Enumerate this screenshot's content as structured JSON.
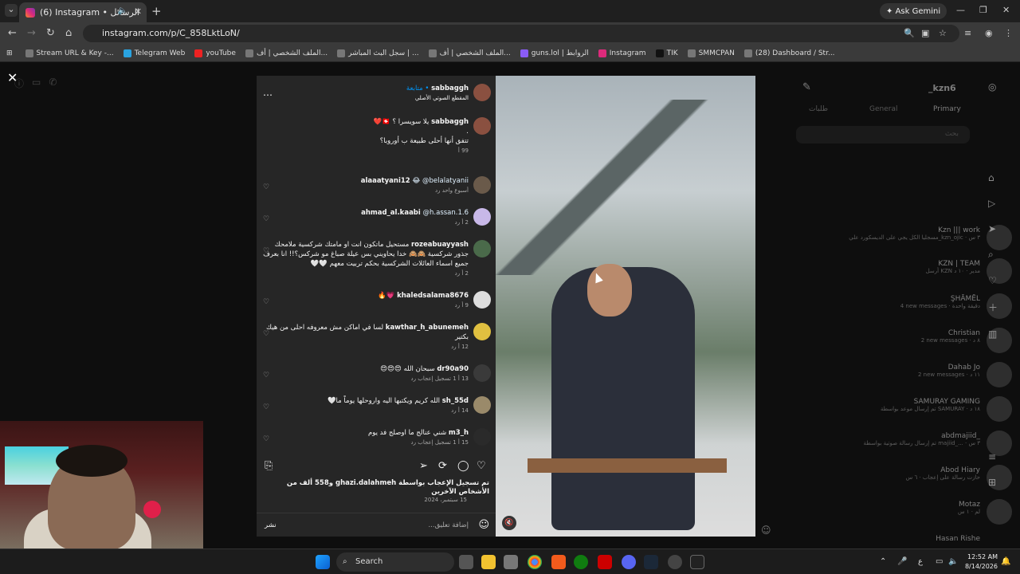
{
  "browser": {
    "tab_title": "(6) Instagram • الرسائل",
    "ask_gemini": "Ask Gemini",
    "url": "instagram.com/p/C_858LktLoN/",
    "bookmarks": [
      "Stream URL & Key -...",
      "Telegram Web",
      "youTube",
      "الملف الشخصي | أف...",
      "سجل البث المباشر | ...",
      "الملف الشخصي | أف...",
      "guns.lol | الروابط",
      "Instagram",
      "TIK",
      "SMMCPAN",
      "(28) Dashboard / Str..."
    ]
  },
  "post": {
    "author": "sabbaggh",
    "follow": "متابعة",
    "audio": "المقطع الصوتي الأصلي",
    "caption_user": "sabbaggh",
    "caption_line1": "يلا سويسرا ؟ 🇨🇭❤️",
    "caption_line2": ".",
    "caption_line3": "تتفق أنها أحلى طبيعة ب أوروبا؟",
    "caption_meta": "99 أ",
    "comments": [
      {
        "user": "alaaatyani12",
        "text": "😂 @belalatyanii",
        "meta": "أسبوع واحد   رد"
      },
      {
        "user": "ahmad_al.kaabi",
        "text": "@h.assan.1.6",
        "meta": "2 أ   رد"
      },
      {
        "user": "rozeabuayyash",
        "text": "مستحيل ماتكون انت او مامتك شركسية ملامحك جذور شركسية 🙈🙈 خدا يحاويني بس عيلة صباغ مو شركس؟!! انا بعرف جميع اسماء العائلات الشركسية بحكم تربيت معهم 🤍🤍",
        "meta": "2 أ   رد"
      },
      {
        "user": "khaledsalama8676",
        "text": "💗🔥",
        "meta": "9 أ   رد"
      },
      {
        "user": "kawthar_h_abunemeh",
        "text": "لسا في اماكن مش معروفه احلى من هيك بكتير",
        "meta": "12 أ   رد"
      },
      {
        "user": "dr90a90",
        "text": "سبحان الله 😍😍😍",
        "meta": "13 أ   1 تسجيل إعجاب   رد"
      },
      {
        "user": "sh_55d",
        "text": "الله كريم ويكتبها اليه واروحلها يوماً ما🤍",
        "meta": "14 أ   رد"
      },
      {
        "user": "m3_h",
        "text": "شني عنالج ما اوصلج فد يوم",
        "meta": "15 أ   1 تسجيل إعجاب   رد"
      }
    ],
    "likes_text": "تم تسجيل الإعجاب بواسطة ghazi.dalahmeh و558 ألف من الأشخاص الآخرين",
    "date": "15 سبتمبر، 2024",
    "add_comment": "إضافة تعليق...",
    "post_button": "نشر"
  },
  "dm_panel": {
    "username": "_kzn6",
    "tabs": [
      "طلبات",
      "General",
      "Primary"
    ],
    "search": "بحث",
    "conversations": [
      {
        "name": "Kzn ||| work",
        "snippet": "مسجليا الكل يجي على الديسكورد علي_kzn_ojic · ٣ س"
      },
      {
        "name": "KZN | TEAM",
        "snippet": "أرسل KZN مدير · ١٠ د"
      },
      {
        "name": "ŞHĀMĒL",
        "snippet": "4 new messages · دقيقة واحدة"
      },
      {
        "name": "Christian",
        "snippet": "2 new messages · ٨ د"
      },
      {
        "name": "Dahab Jo",
        "snippet": "2 new messages · ١١ د"
      },
      {
        "name": "SAMURAY GAMING",
        "snippet": "تم إرسال موعد بواسطة SAMURAY · ١٨ د"
      },
      {
        "name": "abdmajiid_",
        "snippet": "تم إرسال رسالة صوتية بواسطة majiid_... · ٣ س"
      },
      {
        "name": "Abod Hiary",
        "snippet": "حازت رسالة على إعجاب · ٦ س"
      },
      {
        "name": "Motaz",
        "snippet": "لم · ١ س"
      },
      {
        "name": "Hasan Rishe",
        "snippet": ""
      }
    ]
  },
  "taskbar": {
    "search": "Search",
    "time": "12:52 AM",
    "date": "8/14/2026"
  }
}
